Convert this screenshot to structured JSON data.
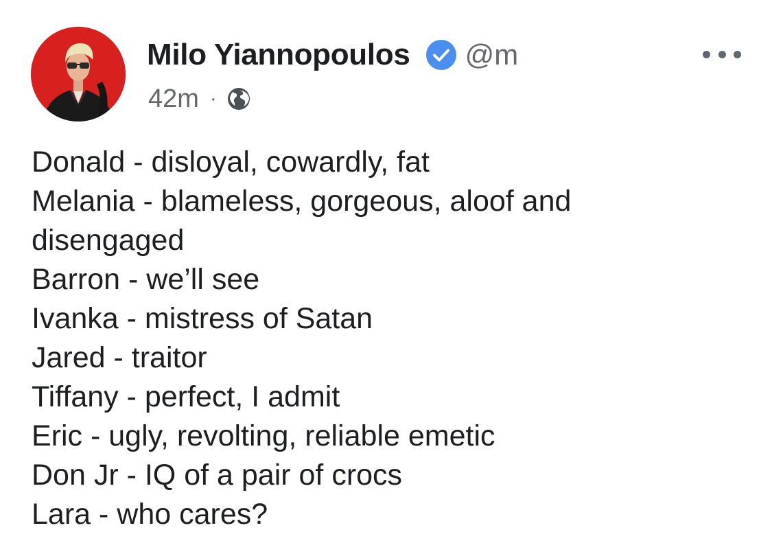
{
  "post": {
    "author": {
      "name": "Milo Yiannopoulos",
      "handle": "@m",
      "verified_icon": "verified-badge-icon",
      "verified_color": "#4a8ef0"
    },
    "timestamp": "42m",
    "separator": "·",
    "audience_icon": "globe-icon",
    "more_icon": "more-options-icon",
    "lines": [
      "Donald - disloyal, cowardly, fat",
      "Melania - blameless, gorgeous, aloof and",
      "disengaged",
      "Barron - we’ll see",
      "Ivanka - mistress of Satan",
      "Jared - traitor",
      "Tiffany - perfect, I admit",
      "Eric - ugly, revolting, reliable emetic",
      "Don Jr - IQ of a pair of crocs",
      "Lara - who cares?"
    ]
  },
  "colors": {
    "avatar_background": "#d8201f",
    "secondary_text": "#65676b",
    "primary_text": "#1c1e21"
  }
}
